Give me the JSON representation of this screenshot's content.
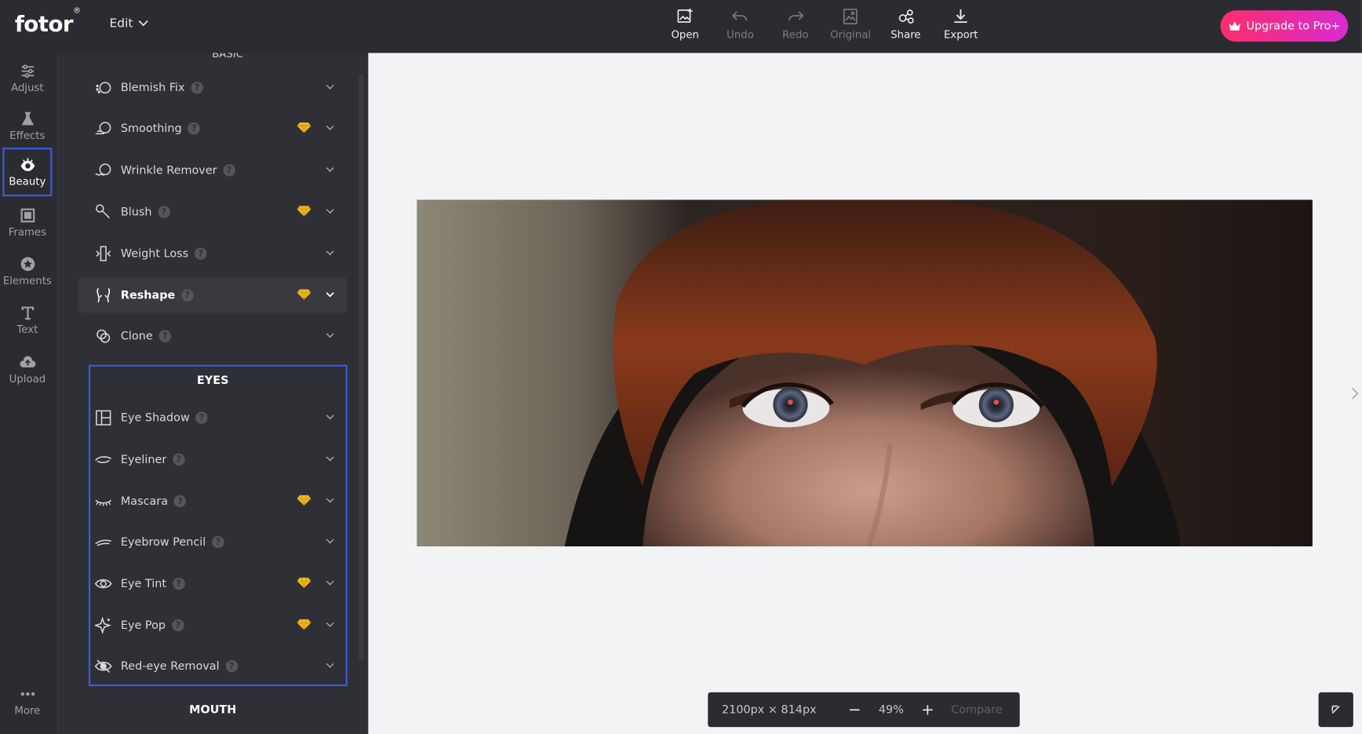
{
  "app": {
    "logo": "fotor",
    "logo_mark": "®"
  },
  "header": {
    "edit_menu": "Edit",
    "tools": [
      {
        "label": "Open",
        "icon": "open-image-icon",
        "enabled": true
      },
      {
        "label": "Undo",
        "icon": "undo-icon",
        "enabled": false
      },
      {
        "label": "Redo",
        "icon": "redo-icon",
        "enabled": false
      },
      {
        "label": "Original",
        "icon": "original-image-icon",
        "enabled": false
      },
      {
        "label": "Share",
        "icon": "share-icon",
        "enabled": true
      },
      {
        "label": "Export",
        "icon": "download-icon",
        "enabled": true
      }
    ],
    "upgrade_label": "Upgrade to Pro+"
  },
  "rail": {
    "items": [
      {
        "label": "Adjust",
        "icon": "sliders-icon",
        "active": false
      },
      {
        "label": "Effects",
        "icon": "flask-icon",
        "active": false
      },
      {
        "label": "Beauty",
        "icon": "eye-icon",
        "active": true
      },
      {
        "label": "Frames",
        "icon": "frame-icon",
        "active": false
      },
      {
        "label": "Elements",
        "icon": "star-badge-icon",
        "active": false
      },
      {
        "label": "Text",
        "icon": "text-t-icon",
        "active": false
      },
      {
        "label": "Upload",
        "icon": "cloud-upload-icon",
        "active": false
      }
    ],
    "more_label": "More"
  },
  "panel": {
    "cut_section": "BASIC",
    "basic_items": [
      {
        "label": "Blemish Fix",
        "pro": false,
        "active": false
      },
      {
        "label": "Smoothing",
        "pro": true,
        "active": false
      },
      {
        "label": "Wrinkle Remover",
        "pro": false,
        "active": false
      },
      {
        "label": "Blush",
        "pro": true,
        "active": false
      },
      {
        "label": "Weight Loss",
        "pro": false,
        "active": false
      },
      {
        "label": "Reshape",
        "pro": true,
        "active": true
      },
      {
        "label": "Clone",
        "pro": false,
        "active": false
      }
    ],
    "eyes_title": "EYES",
    "eyes_items": [
      {
        "label": "Eye Shadow",
        "pro": false
      },
      {
        "label": "Eyeliner",
        "pro": false
      },
      {
        "label": "Mascara",
        "pro": true
      },
      {
        "label": "Eyebrow Pencil",
        "pro": false
      },
      {
        "label": "Eye Tint",
        "pro": true
      },
      {
        "label": "Eye Pop",
        "pro": true
      },
      {
        "label": "Red-eye Removal",
        "pro": false
      }
    ],
    "mouth_title": "MOUTH",
    "help_glyph": "?"
  },
  "canvas": {
    "dimensions": "2100px × 814px",
    "zoom": "49%",
    "compare_label": "Compare"
  },
  "colors": {
    "accent": "#3b5bdb",
    "pro_gem": "#f2b824",
    "upgrade_start": "#ff2d6a",
    "upgrade_end": "#d92bd0"
  }
}
